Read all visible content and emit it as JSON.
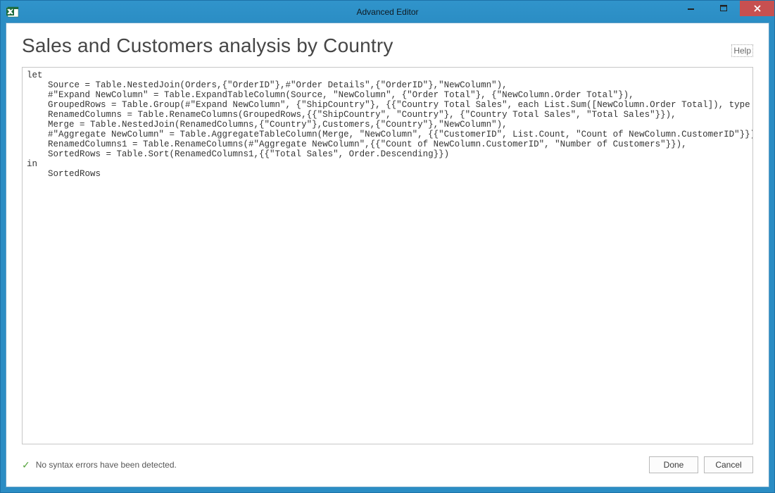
{
  "window": {
    "title": "Advanced Editor"
  },
  "page": {
    "heading": "Sales and Customers analysis by Country",
    "help_label": "Help"
  },
  "editor": {
    "code": "let\n    Source = Table.NestedJoin(Orders,{\"OrderID\"},#\"Order Details\",{\"OrderID\"},\"NewColumn\"),\n    #\"Expand NewColumn\" = Table.ExpandTableColumn(Source, \"NewColumn\", {\"Order Total\"}, {\"NewColumn.Order Total\"}),\n    GroupedRows = Table.Group(#\"Expand NewColumn\", {\"ShipCountry\"}, {{\"Country Total Sales\", each List.Sum([NewColumn.Order Total]), type number}}),\n    RenamedColumns = Table.RenameColumns(GroupedRows,{{\"ShipCountry\", \"Country\"}, {\"Country Total Sales\", \"Total Sales\"}}),\n    Merge = Table.NestedJoin(RenamedColumns,{\"Country\"},Customers,{\"Country\"},\"NewColumn\"),\n    #\"Aggregate NewColumn\" = Table.AggregateTableColumn(Merge, \"NewColumn\", {{\"CustomerID\", List.Count, \"Count of NewColumn.CustomerID\"}}),\n    RenamedColumns1 = Table.RenameColumns(#\"Aggregate NewColumn\",{{\"Count of NewColumn.CustomerID\", \"Number of Customers\"}}),\n    SortedRows = Table.Sort(RenamedColumns1,{{\"Total Sales\", Order.Descending}})\nin\n    SortedRows"
  },
  "status": {
    "text": "No syntax errors have been detected."
  },
  "buttons": {
    "done": "Done",
    "cancel": "Cancel"
  }
}
